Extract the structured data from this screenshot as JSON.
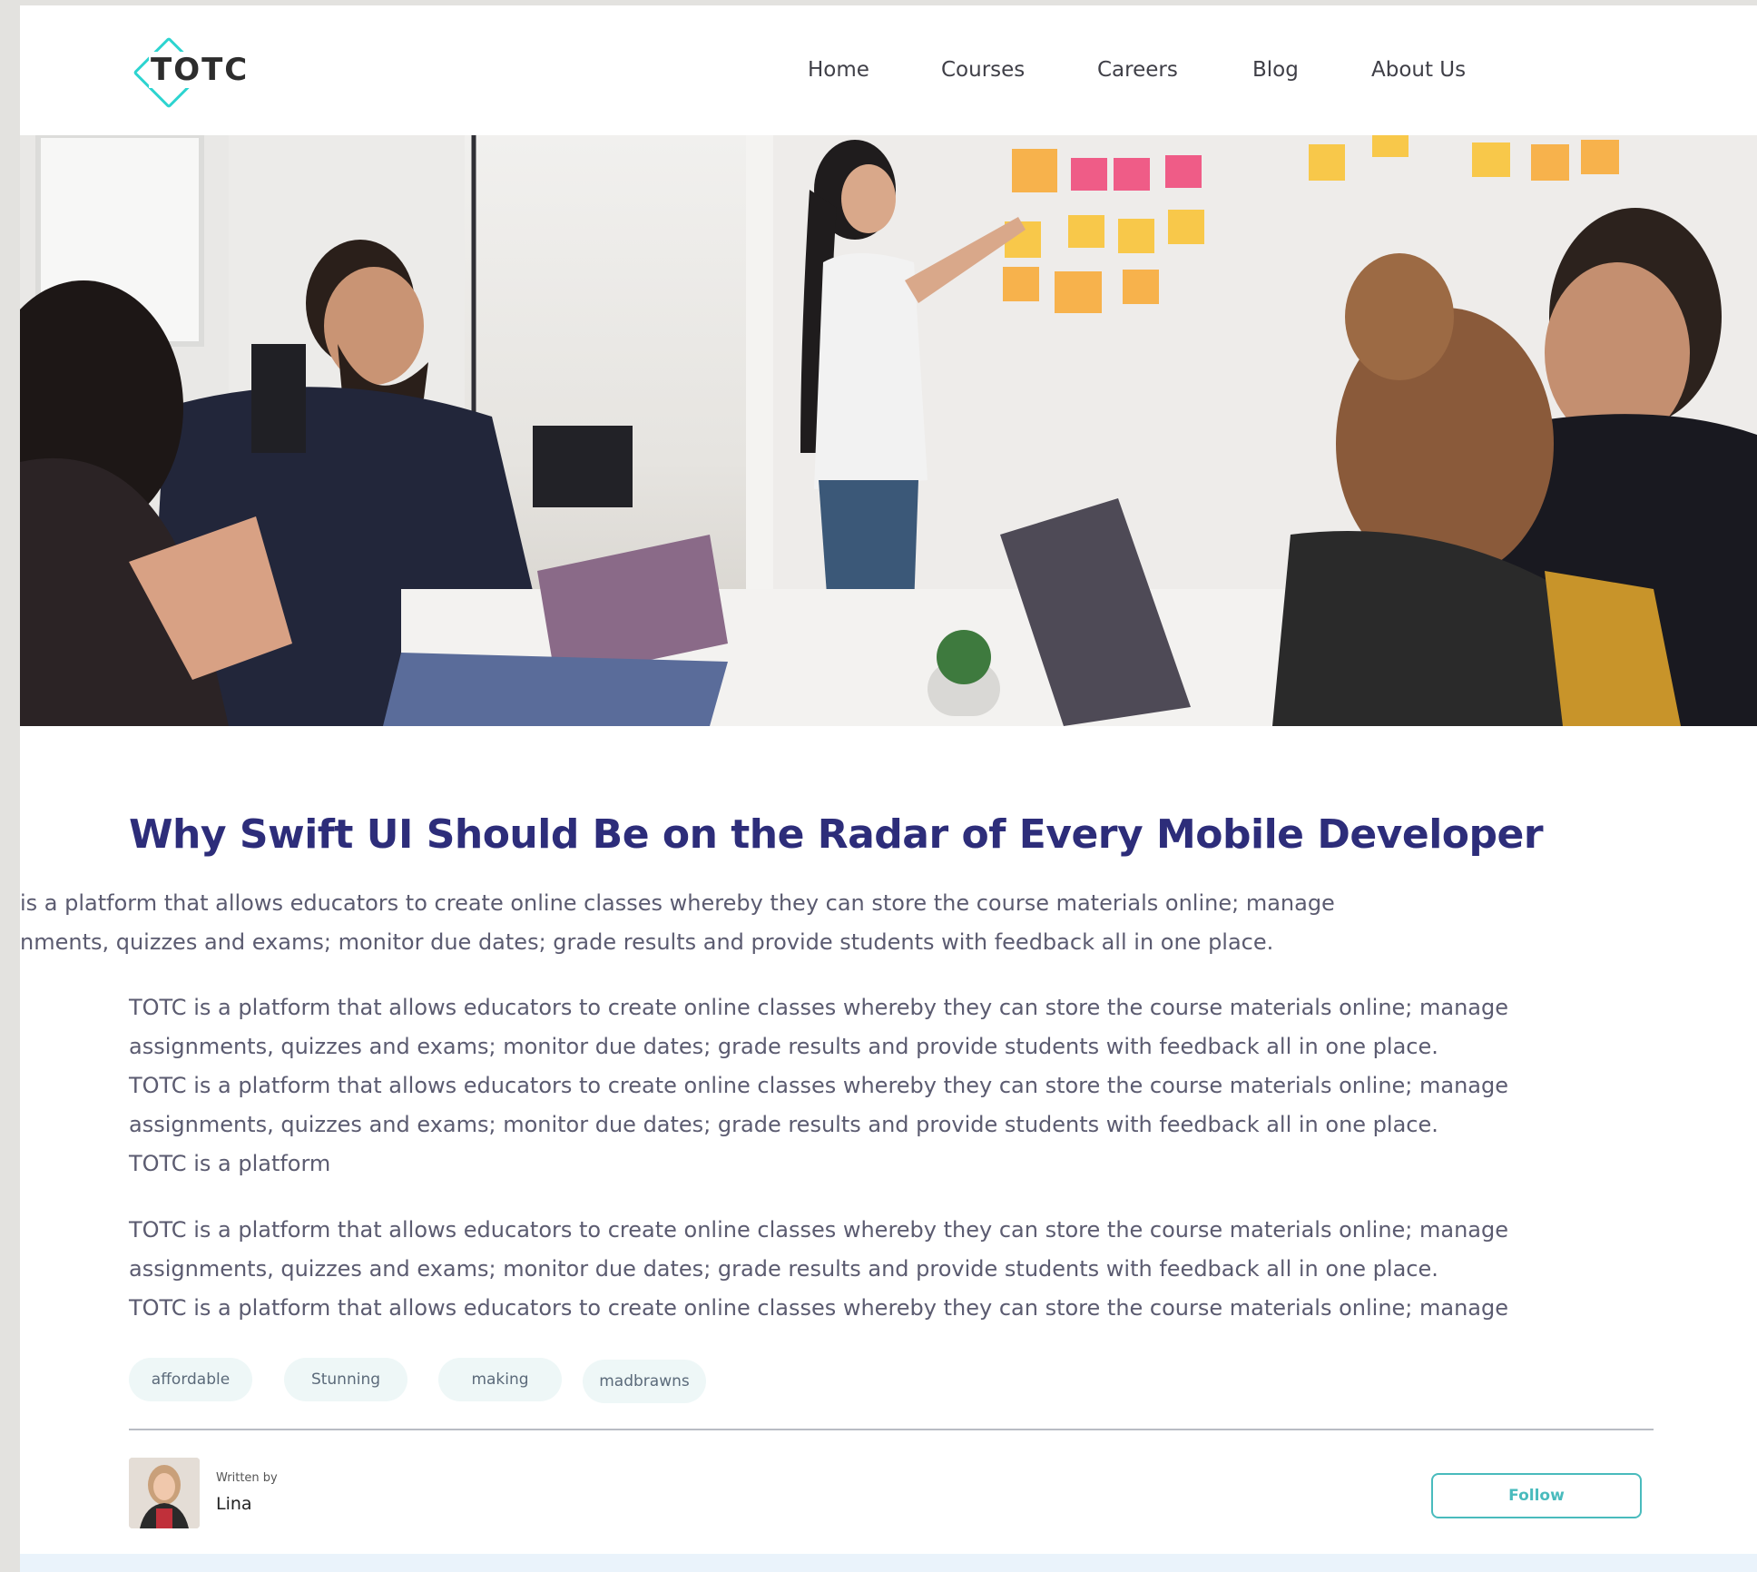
{
  "brand": {
    "logo_text": "TOTC",
    "accent_color": "#2dd4d0",
    "title_color": "#2d2d7a",
    "follow_color": "#49bbbd"
  },
  "nav": {
    "items": [
      {
        "label": "Home"
      },
      {
        "label": "Courses"
      },
      {
        "label": "Careers"
      },
      {
        "label": "Blog"
      },
      {
        "label": "About Us"
      }
    ]
  },
  "hero": {
    "image": "classroom-team-meeting-photo"
  },
  "article": {
    "title": "Why Swift UI Should Be on the Radar of Every Mobile Developer",
    "intro_lines": [
      "is a platform that allows educators to create online classes whereby they can store the course materials online; manage",
      "nments, quizzes and exams; monitor due dates; grade results and provide students with feedback all in one place."
    ],
    "body_1_lines": [
      "TOTC is a platform that allows educators to create online classes whereby they can store the course materials online; manage",
      "assignments, quizzes and exams; monitor due dates; grade results and provide students with feedback all in one place.",
      "TOTC is a platform that allows educators to create online classes whereby they can store the course materials online; manage",
      "assignments, quizzes and exams; monitor due dates; grade results and provide students with feedback all in one place.",
      "TOTC is a platform"
    ],
    "body_2_lines": [
      "TOTC is a platform that allows educators to create online classes whereby they can store the course materials online; manage",
      "assignments, quizzes and exams; monitor due dates; grade results and provide students with feedback all in one place.",
      "TOTC is a platform that allows educators to create online classes whereby they can store the course materials online; manage"
    ]
  },
  "tags": [
    {
      "label": "affordable"
    },
    {
      "label": "Stunning"
    },
    {
      "label": "making"
    },
    {
      "label": "madbrawns"
    }
  ],
  "author": {
    "written_by_label": "Written by",
    "name": "Lina",
    "follow_label": "Follow"
  }
}
